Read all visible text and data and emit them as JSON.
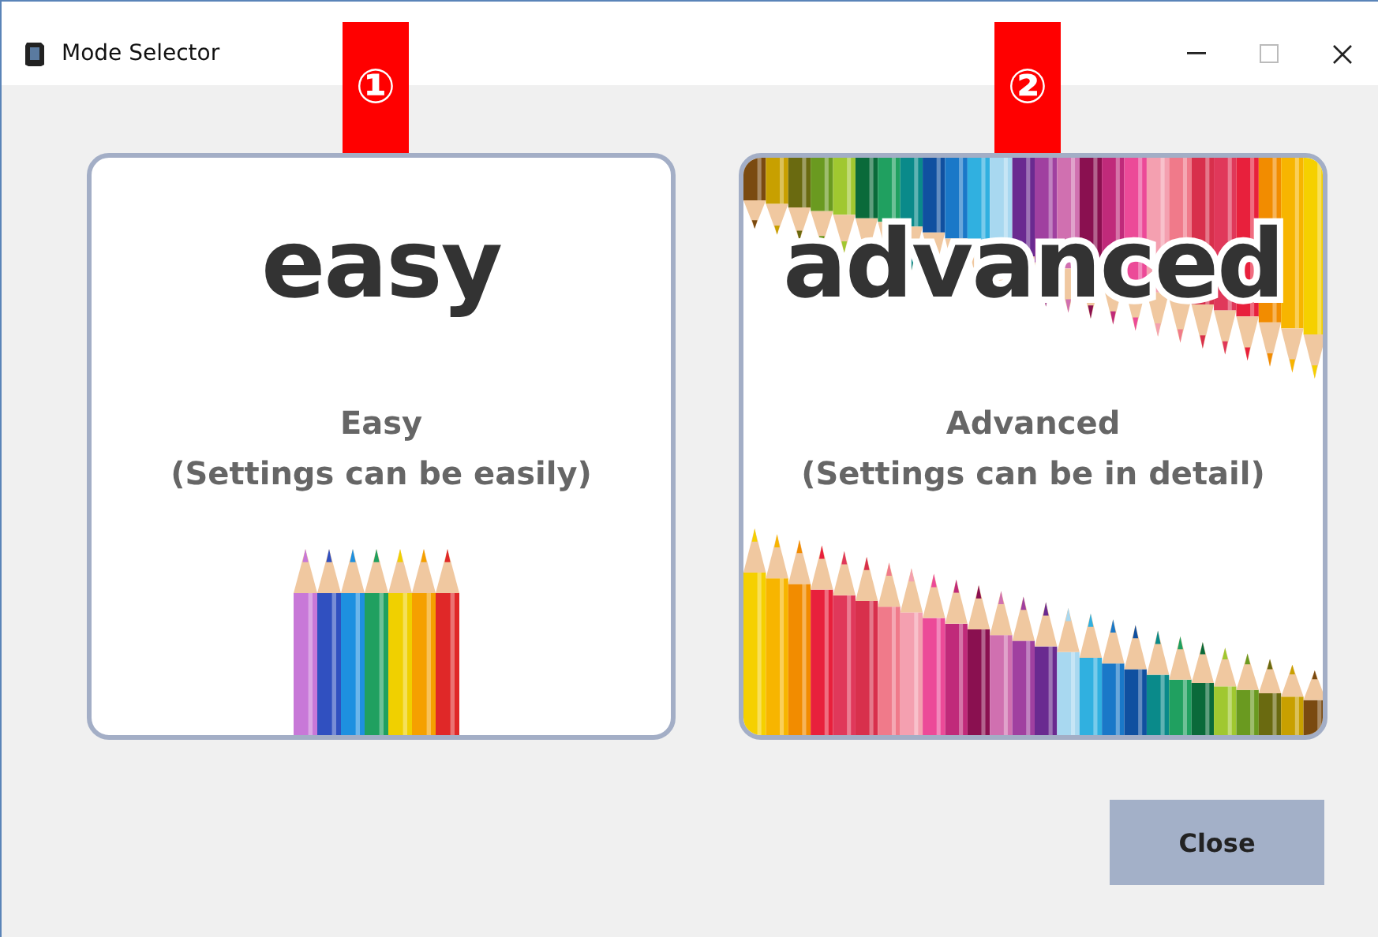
{
  "window": {
    "title": "Mode Selector"
  },
  "annotations": [
    {
      "label": "①"
    },
    {
      "label": "②"
    }
  ],
  "modes": [
    {
      "kind": "easy",
      "logo": "easy",
      "title": "Easy",
      "description": "(Settings can be easily)"
    },
    {
      "kind": "advanced",
      "logo": "advanced",
      "title": "Advanced",
      "description": "(Settings can be in detail)"
    }
  ],
  "buttons": [
    {
      "label": "Close"
    }
  ]
}
